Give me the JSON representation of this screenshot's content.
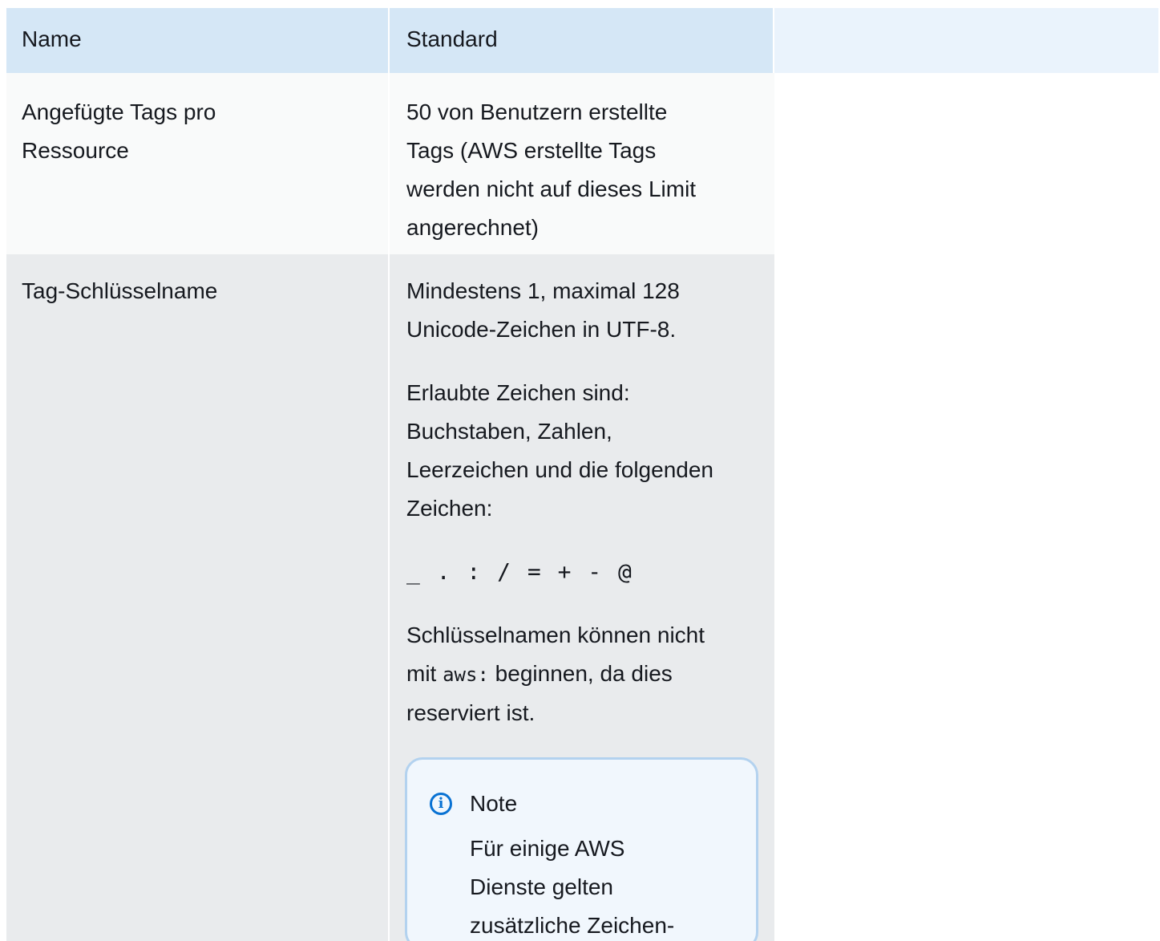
{
  "table": {
    "headers": [
      "Name",
      "Standard"
    ],
    "rows": [
      {
        "name": [
          "Angefügte Tags pro",
          "Ressource"
        ],
        "standard": [
          "50 von Benutzern erstellte",
          "Tags (AWS erstellte Tags",
          "werden nicht auf dieses Limit",
          "angerechnet)"
        ]
      },
      {
        "name": [
          "Tag-Schlüsselname"
        ],
        "standard_p1": [
          "Mindestens 1, maximal 128",
          "Unicode-Zeichen in UTF-8."
        ],
        "standard_p2": [
          "Erlaubte Zeichen sind:",
          "Buchstaben, Zahlen,",
          "Leerzeichen und die folgenden",
          "Zeichen:"
        ],
        "allowed_chars": "_ . : / = + - @",
        "standard_p3_line1": "Schlüsselnamen können nicht",
        "standard_p3_pre": "mit ",
        "standard_p3_code": "aws:",
        "standard_p3_post": " beginnen, da dies",
        "standard_p3_line3": "reserviert ist.",
        "note": {
          "icon": "info-icon",
          "title": "Note",
          "body": [
            "Für einige AWS",
            "Dienste gelten",
            "zusätzliche Zeichen-"
          ]
        }
      }
    ]
  },
  "colors": {
    "header_bg": "#d5e7f6",
    "row_odd_bg": "#f9fafa",
    "row_even_bg": "#e9ebed",
    "note_bg": "#f1f7fd",
    "note_border": "#b3d2ef",
    "accent": "#0972d3"
  }
}
